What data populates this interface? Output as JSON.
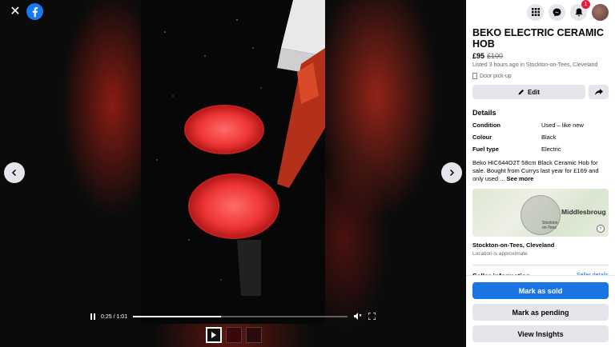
{
  "viewer": {
    "time_display": "0:25 / 1:01",
    "progress_fraction": 0.41
  },
  "listing": {
    "title": "BEKO ELECTRIC CERAMIC HOB",
    "price": "£95",
    "old_price": "£100",
    "listed": "Listed 3 hours ago in Stockton-on-Tees, Cleveland",
    "pickup": "Door pick-up",
    "edit_label": "Edit"
  },
  "details": {
    "heading": "Details",
    "rows": [
      {
        "key": "Condition",
        "value": "Used – like new"
      },
      {
        "key": "Colour",
        "value": "Black"
      },
      {
        "key": "Fuel type",
        "value": "Electric"
      }
    ],
    "description": "Beko HIC644O2T 58cm Black Ceramic Hob for sale. Bought from Currys last year for £169 and only used ...",
    "see_more": "See more"
  },
  "map": {
    "town_large": "Middlesbroug",
    "town_small_line1": "Stockton-",
    "town_small_line2": "on-Tees",
    "info_icon": "i"
  },
  "location": {
    "name": "Stockton-on-Tees, Cleveland",
    "note": "Location is approximate"
  },
  "seller": {
    "heading": "Seller information",
    "link": "Seller details"
  },
  "actions": {
    "mark_sold": "Mark as sold",
    "mark_pending": "Mark as pending",
    "view_insights": "View Insights"
  },
  "topbar": {
    "notification_count": "1"
  },
  "colors": {
    "accent": "#1b74e4",
    "badge": "#e41e3f"
  }
}
